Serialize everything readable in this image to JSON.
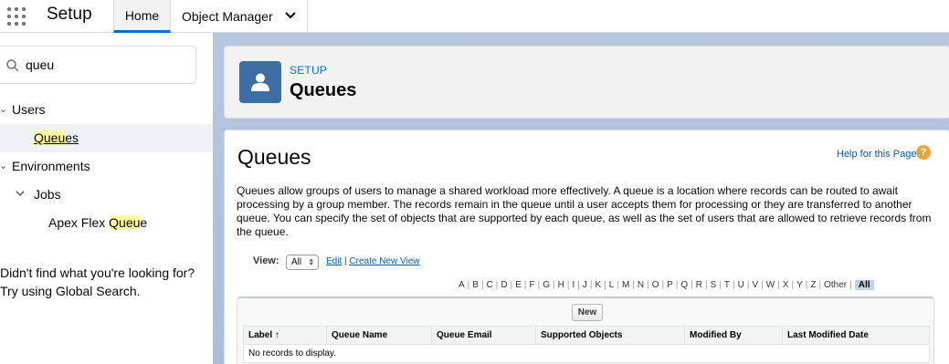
{
  "topbar": {
    "app_name": "Setup",
    "tabs": [
      {
        "label": "Home",
        "active": true
      },
      {
        "label": "Object Manager",
        "active": false
      }
    ]
  },
  "sidebar": {
    "search_value": "queu",
    "tree": {
      "users": "Users",
      "queues_pre": "",
      "queues_hl": "Queu",
      "queues_post": "es",
      "environments": "Environments",
      "jobs": "Jobs",
      "apex_pre": "Apex Flex ",
      "apex_hl": "Queu",
      "apex_post": "e"
    },
    "not_found_line1": "Didn't find what you're looking for?",
    "not_found_line2": "Try using Global Search."
  },
  "header": {
    "breadcrumb": "SETUP",
    "title": "Queues"
  },
  "content": {
    "title": "Queues",
    "help_link": "Help for this Page",
    "help_icon": "?",
    "description": "Queues allow groups of users to manage a shared workload more effectively. A queue is a location where records can be routed to await processing by a group member. The records remain in the queue until a user accepts them for processing or they are transferred to another queue. You can specify the set of objects that are supported by each queue, as well as the set of users that are allowed to retrieve records from the queue.",
    "view_label": "View:",
    "view_selected": "All",
    "edit_link": "Edit",
    "separator": "|",
    "create_view_link": "Create New View",
    "alphabet": [
      "A",
      "B",
      "C",
      "D",
      "E",
      "F",
      "G",
      "H",
      "I",
      "J",
      "K",
      "L",
      "M",
      "N",
      "O",
      "P",
      "Q",
      "R",
      "S",
      "T",
      "U",
      "V",
      "W",
      "X",
      "Y",
      "Z",
      "Other"
    ],
    "alphabet_all": "All",
    "new_button": "New",
    "table_headers": [
      "Label ↑",
      "Queue Name",
      "Queue Email",
      "Supported Objects",
      "Modified By",
      "Last Modified Date"
    ],
    "empty_message": "No records to display."
  },
  "colors": {
    "accent": "#0070d2",
    "header_icon_bg": "#3c6ea3",
    "highlight": "#fff79e",
    "main_bg": "#b0c4df"
  }
}
